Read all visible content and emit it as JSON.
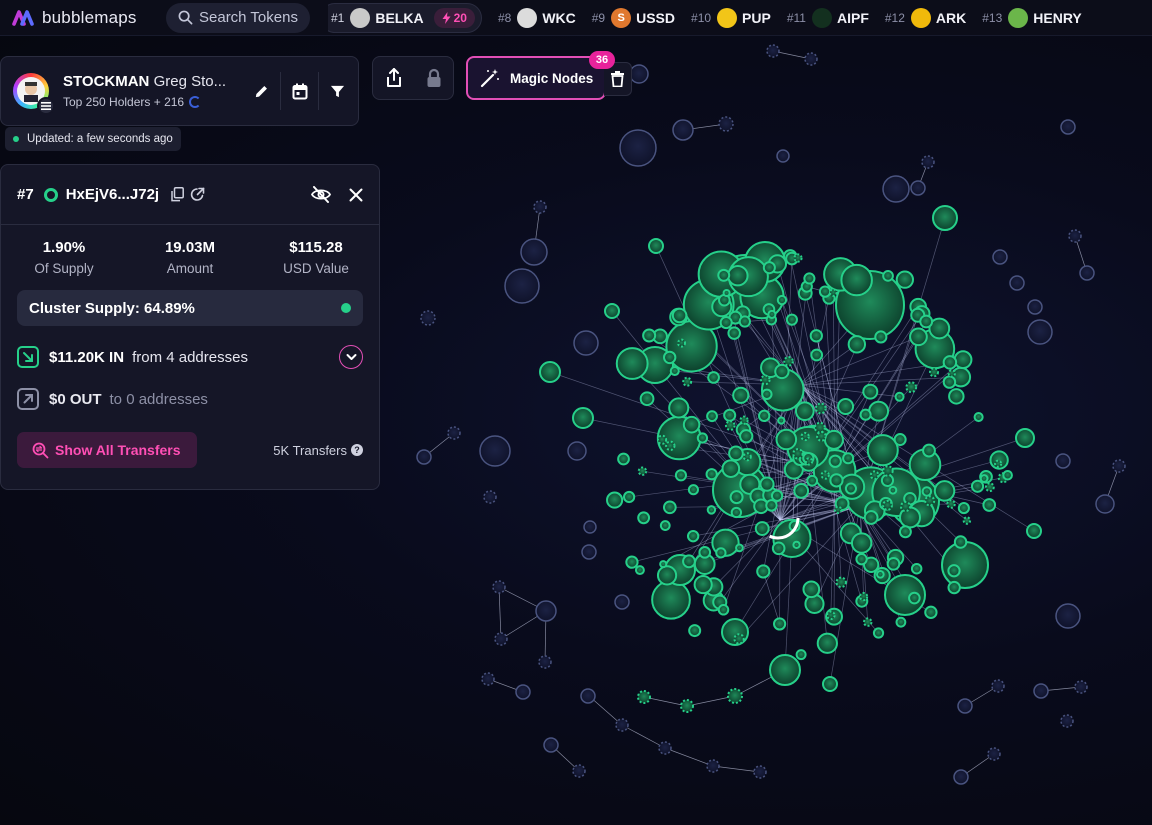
{
  "brand": {
    "name": "bubblemaps"
  },
  "search": {
    "placeholder": "Search Tokens"
  },
  "ticker": [
    {
      "rank": "#1",
      "symbol": "BELKA",
      "boost": "20",
      "coin_color": "#c9c9c9",
      "coin_glyph": ""
    },
    {
      "rank": "#8",
      "symbol": "WKC",
      "coin_color": "#dcdcdc",
      "coin_glyph": ""
    },
    {
      "rank": "#9",
      "symbol": "USSD",
      "coin_color": "#e0782e",
      "coin_glyph": "S"
    },
    {
      "rank": "#10",
      "symbol": "PUP",
      "coin_color": "#f2c518",
      "coin_glyph": ""
    },
    {
      "rank": "#11",
      "symbol": "AIPF",
      "coin_color": "#13301f",
      "coin_glyph": ""
    },
    {
      "rank": "#12",
      "symbol": "ARK",
      "coin_color": "#f0b90b",
      "coin_glyph": ""
    },
    {
      "rank": "#13",
      "symbol": "HENRY",
      "coin_color": "#6bb64a",
      "coin_glyph": ""
    }
  ],
  "token": {
    "symbol": "STOCKMAN",
    "full_name": "Greg Sto...",
    "subtitle": "Top 250 Holders + 216"
  },
  "updated": {
    "text": "Updated: a few seconds ago"
  },
  "magic": {
    "label": "Magic Nodes",
    "count": "36"
  },
  "detail": {
    "rank": "#7",
    "address": "HxEjV6...J72j",
    "stats": [
      {
        "value": "1.90%",
        "label": "Of Supply"
      },
      {
        "value": "19.03M",
        "label": "Amount"
      },
      {
        "value": "$115.28",
        "label": "USD Value"
      }
    ],
    "cluster_supply": "Cluster Supply: 64.89%",
    "in": {
      "amount": "$11.20K IN",
      "desc": "from 4 addresses"
    },
    "out": {
      "amount": "$0 OUT",
      "desc": "to 0 addresses"
    },
    "show_transfers": "Show All Transfers",
    "transfers_count": "5K Transfers"
  },
  "colors": {
    "accent": "#e24fb6",
    "cluster_green": "#26d08a",
    "background": "#090b1c"
  }
}
